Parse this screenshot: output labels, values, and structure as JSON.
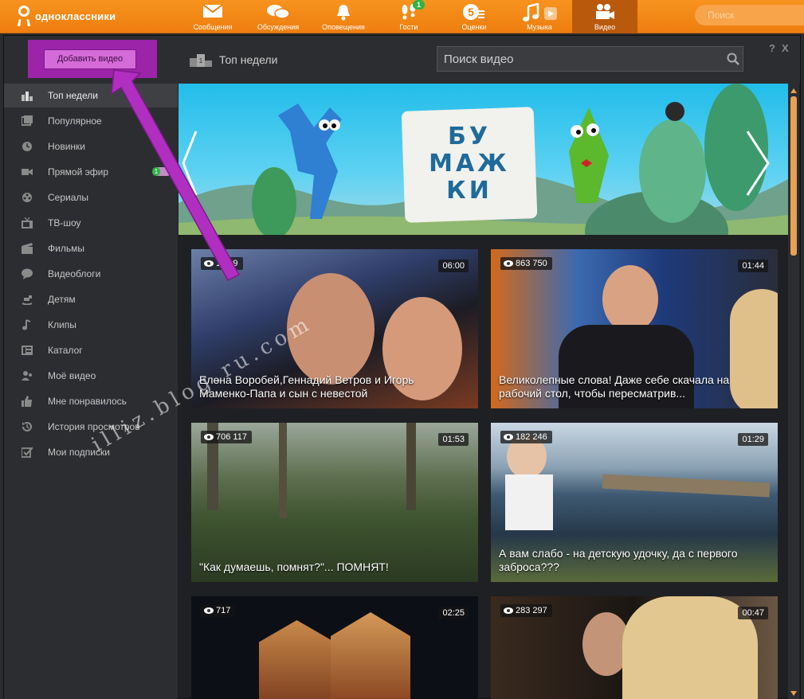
{
  "topbar": {
    "logo_text": "одноклассники",
    "nav": [
      {
        "label": "Сообщения",
        "icon": "envelope-icon"
      },
      {
        "label": "Обсуждения",
        "icon": "chat-bubbles-icon"
      },
      {
        "label": "Оповещения",
        "icon": "bell-icon"
      },
      {
        "label": "Гости",
        "icon": "footprints-icon",
        "badge": "1"
      },
      {
        "label": "Оценки",
        "icon": "rating-icon"
      },
      {
        "label": "Музыка",
        "icon": "music-note-icon"
      },
      {
        "label": "Видео",
        "icon": "video-camera-icon",
        "active": true
      }
    ],
    "search_placeholder": "Поиск"
  },
  "header": {
    "add_video_label": "Добавить видео",
    "page_title": "Топ недели",
    "search_placeholder": "Поиск видео",
    "help_label": "?",
    "close_label": "X"
  },
  "sidebar": {
    "items": [
      {
        "label": "Топ недели",
        "icon": "podium-icon",
        "active": true
      },
      {
        "label": "Популярное",
        "icon": "film-stack-icon"
      },
      {
        "label": "Новинки",
        "icon": "clock-icon"
      },
      {
        "label": "Прямой эфир",
        "icon": "camera-icon",
        "badge": "1"
      },
      {
        "label": "Сериалы",
        "icon": "film-reel-icon"
      },
      {
        "label": "ТВ-шоу",
        "icon": "tv-icon"
      },
      {
        "label": "Фильмы",
        "icon": "clapperboard-icon"
      },
      {
        "label": "Видеоблоги",
        "icon": "speech-bubble-icon"
      },
      {
        "label": "Детям",
        "icon": "rocking-horse-icon"
      },
      {
        "label": "Клипы",
        "icon": "music-note-icon"
      },
      {
        "label": "Каталог",
        "icon": "catalog-icon"
      },
      {
        "label": "Моё видео",
        "icon": "user-icon"
      },
      {
        "label": "Мне понравилось",
        "icon": "thumbs-up-icon"
      },
      {
        "label": "История просмотров",
        "icon": "history-icon"
      },
      {
        "label": "Мои подписки",
        "icon": "subscriptions-icon"
      }
    ]
  },
  "banner": {
    "title_lines": [
      "БУ",
      "МАЖ",
      "КИ"
    ]
  },
  "videos": [
    {
      "views": "1 309",
      "duration": "06:00",
      "title": "Елена Воробей,Геннадий Ветров и Игорь Маменко-Папа и сын с невестой"
    },
    {
      "views": "863 750",
      "duration": "01:44",
      "title": "Великолепные слова! Даже себе скачала на рабочий стол, чтобы пересматрив..."
    },
    {
      "views": "706 117",
      "duration": "01:53",
      "title": "\"Как думаешь, помнят?\"... ПОМНЯТ!"
    },
    {
      "views": "182 246",
      "duration": "01:29",
      "title": "А вам слабо - на детскую удочку, да с первого заброса???"
    },
    {
      "views": "717",
      "duration": "02:25",
      "title": ""
    },
    {
      "views": "283 297",
      "duration": "00:47",
      "title": ""
    }
  ],
  "watermark": "illiz.blog.ru.com",
  "colors": {
    "brand_orange": "#f7931e",
    "highlight_purple": "#9b24a9",
    "arrow_purple": "#b02fc0",
    "live_green": "#2fb343"
  }
}
